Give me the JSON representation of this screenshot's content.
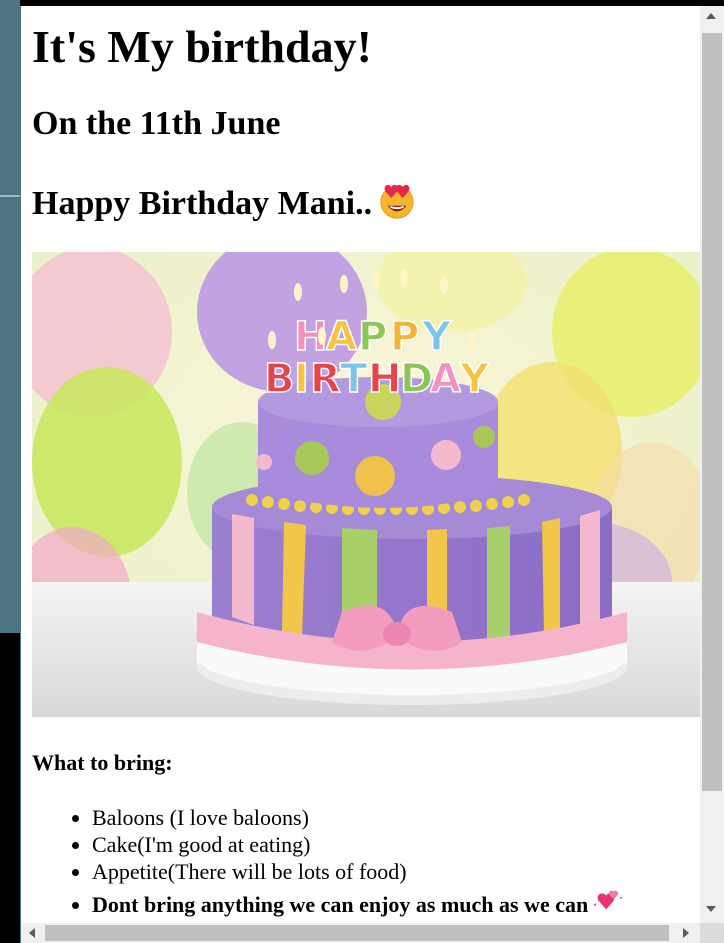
{
  "heading": "It's My birthday!",
  "date_line": "On the 11th June",
  "wish_line": "Happy Birthday Mani..",
  "wish_emoji": "heart-eyes-emoji",
  "image": {
    "topper_text": "HAPPY BIRTHDAY"
  },
  "bring_title": "What to bring:",
  "bring_items": [
    "Baloons (I love baloons)",
    "Cake(I'm good at eating)",
    "Appetite(There will be lots of food)",
    "Dont bring anything we can enjoy as much as we can"
  ],
  "last_item_emoji": "two-hearts-emoji",
  "colors": {
    "page_background": "#ffffff",
    "frame": "#4e7381",
    "text": "#000000"
  }
}
